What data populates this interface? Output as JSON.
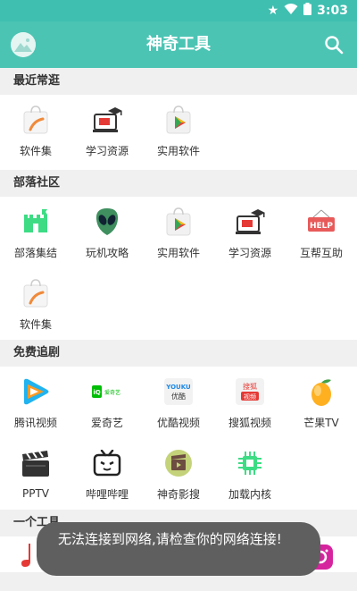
{
  "status_bar": {
    "time": "3:03"
  },
  "app_bar": {
    "title": "神奇工具"
  },
  "sections": [
    {
      "title": "最近常逛",
      "items": [
        "软件集",
        "学习资源",
        "实用软件"
      ]
    },
    {
      "title": "部落社区",
      "items": [
        "部落集结",
        "玩机攻略",
        "实用软件",
        "学习资源",
        "互帮互助",
        "软件集"
      ]
    },
    {
      "title": "免费追剧",
      "items": [
        "腾讯视频",
        "爱奇艺",
        "优酷视频",
        "搜狐视频",
        "芒果TV",
        "PPTV",
        "哔哩哔哩",
        "神奇影搜",
        "加载内核"
      ]
    },
    {
      "title": "一个工具"
    }
  ],
  "toast": {
    "message": "无法连接到网络,请检查你的网络连接!"
  },
  "icon_badges": {
    "help": "HELP",
    "youku": "YOUKU\n优酷",
    "iqiyi": "爱奇艺",
    "sohu": "搜狐\n视频"
  },
  "colors": {
    "accent": "#4cc4b4",
    "status_bar": "#3fbfb0"
  }
}
